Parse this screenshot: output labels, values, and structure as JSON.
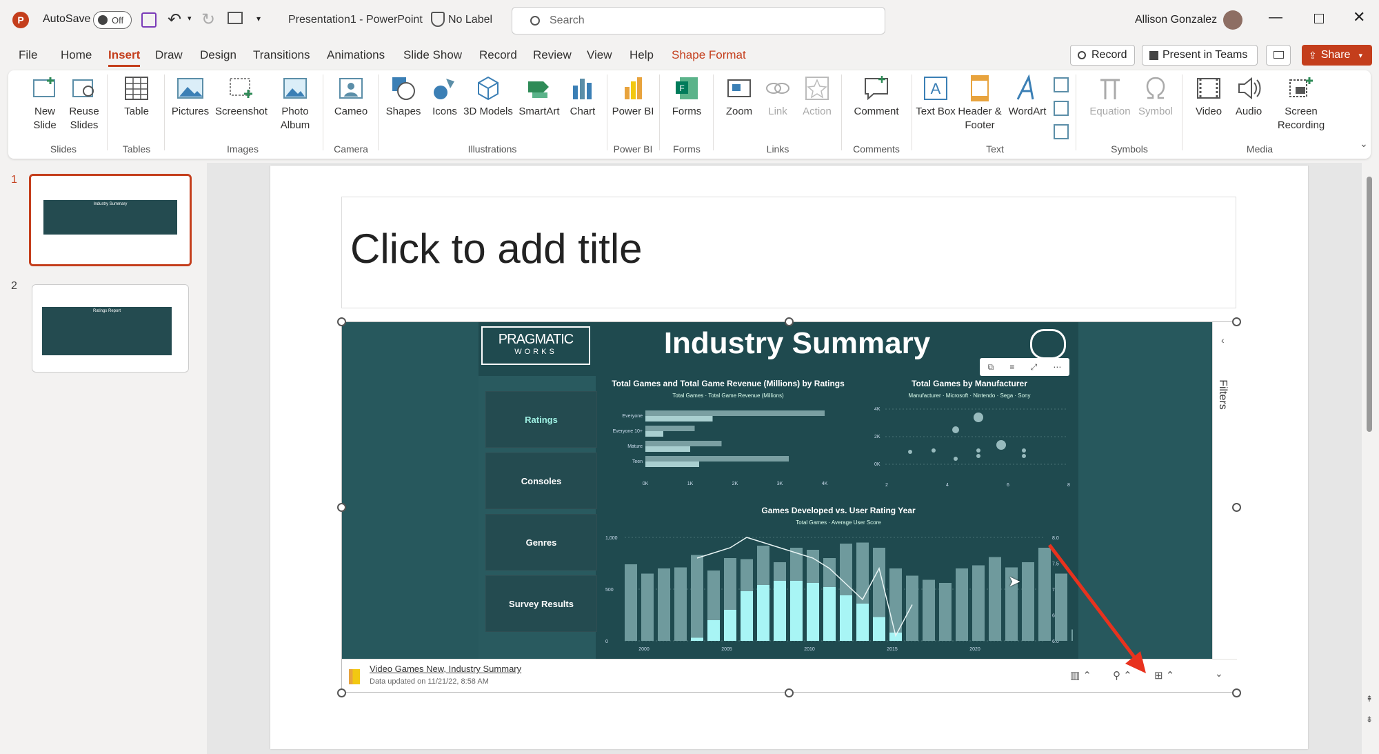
{
  "app": {
    "autosave_label": "AutoSave",
    "autosave_state": "Off",
    "doc_title": "Presentation1 - PowerPoint",
    "label": "No Label",
    "search_placeholder": "Search",
    "user": "Allison Gonzalez"
  },
  "tabs": [
    "File",
    "Home",
    "Insert",
    "Draw",
    "Design",
    "Transitions",
    "Animations",
    "Slide Show",
    "Record",
    "Review",
    "View",
    "Help",
    "Shape Format"
  ],
  "active_tab": "Insert",
  "tab_actions": {
    "record": "Record",
    "present": "Present in Teams",
    "share": "Share"
  },
  "ribbon": {
    "slides": {
      "new_slide": "New Slide",
      "reuse": "Reuse Slides",
      "label": "Slides"
    },
    "tables": {
      "table": "Table",
      "label": "Tables"
    },
    "images": {
      "pictures": "Pictures",
      "screenshot": "Screenshot",
      "photo_album": "Photo Album",
      "label": "Images"
    },
    "camera": {
      "cameo": "Cameo",
      "label": "Camera"
    },
    "illustrations": {
      "shapes": "Shapes",
      "icons": "Icons",
      "models": "3D Models",
      "smartart": "SmartArt",
      "chart": "Chart",
      "label": "Illustrations"
    },
    "powerbi": {
      "btn": "Power BI",
      "label": "Power BI"
    },
    "forms": {
      "btn": "Forms",
      "label": "Forms"
    },
    "links": {
      "zoom": "Zoom",
      "link": "Link",
      "action": "Action",
      "label": "Links"
    },
    "comments": {
      "btn": "Comment",
      "label": "Comments"
    },
    "text": {
      "textbox": "Text Box",
      "header": "Header & Footer",
      "wordart": "WordArt",
      "label": "Text"
    },
    "symbols": {
      "equation": "Equation",
      "symbol": "Symbol",
      "label": "Symbols"
    },
    "media": {
      "video": "Video",
      "audio": "Audio",
      "screen_rec": "Screen Recording",
      "label": "Media"
    }
  },
  "thumbnails": [
    {
      "num": "1",
      "title": "Industry Summary"
    },
    {
      "num": "2",
      "title": "Ratings Report"
    }
  ],
  "slide": {
    "title_placeholder": "Click to add title"
  },
  "report": {
    "logo_main": "PRAGMATIC",
    "logo_sub": "WORKS",
    "title": "Industry Summary",
    "nav": [
      "Ratings",
      "Consoles",
      "Genres",
      "Survey Results"
    ],
    "filters": "Filters",
    "footer_title": "Video Games New, Industry Summary",
    "footer_updated": "Data updated on 11/21/22, 8:58 AM"
  },
  "chart_data": [
    {
      "type": "bar",
      "title": "Total Games and Total Game Revenue (Millions) by Ratings",
      "categories": [
        "Everyone",
        "Everyone 10+",
        "Mature",
        "Teen"
      ],
      "series": [
        {
          "name": "Total Games",
          "values": [
            4000,
            1100,
            1700,
            3200
          ]
        },
        {
          "name": "Total Game Revenue (Millions)",
          "values": [
            1500,
            400,
            1000,
            1200
          ]
        }
      ],
      "xticks": [
        "0K",
        "1K",
        "2K",
        "3K",
        "4K"
      ]
    },
    {
      "type": "scatter",
      "title": "Total Games by Manufacturer",
      "legend_label": "Manufacturer",
      "series": [
        {
          "name": "Microsoft"
        },
        {
          "name": "Nintendo"
        },
        {
          "name": "Sega"
        },
        {
          "name": "Sony"
        }
      ],
      "xticks": [
        "2",
        "4",
        "6",
        "8"
      ],
      "yticks": [
        "4K",
        "2K",
        "0K"
      ]
    },
    {
      "type": "bar",
      "title": "Games Developed vs. User Rating Year",
      "series": [
        {
          "name": "Total Games",
          "values": [
            740,
            650,
            700,
            710,
            830,
            680,
            800,
            790,
            920,
            760,
            900,
            880,
            800,
            940,
            950,
            900,
            700,
            630,
            590,
            560,
            700,
            730,
            810,
            710,
            760,
            900,
            650,
            110,
            240
          ]
        },
        {
          "name": "Average User Score",
          "values": [
            null,
            null,
            null,
            null,
            7.6,
            7.7,
            7.8,
            8.0,
            7.9,
            7.8,
            7.7,
            7.6,
            7.4,
            7.1,
            6.8,
            7.4,
            6.1,
            6.7,
            null,
            null,
            null,
            null,
            null,
            null,
            null,
            null,
            null,
            null,
            null
          ]
        }
      ],
      "overlay_values": [
        0,
        0,
        0,
        0,
        30,
        200,
        300,
        480,
        540,
        580,
        580,
        560,
        520,
        440,
        360,
        230,
        80,
        0,
        0,
        0,
        0,
        0,
        0,
        0,
        0,
        0,
        0,
        0,
        0
      ],
      "xticks": [
        "2000",
        "2005",
        "2010",
        "2015",
        "2020"
      ],
      "yticks_left": [
        "1,000",
        "500",
        "0"
      ],
      "yticks_right": [
        "8.0",
        "7.5",
        "7.0",
        "6.5",
        "6.0"
      ]
    }
  ]
}
